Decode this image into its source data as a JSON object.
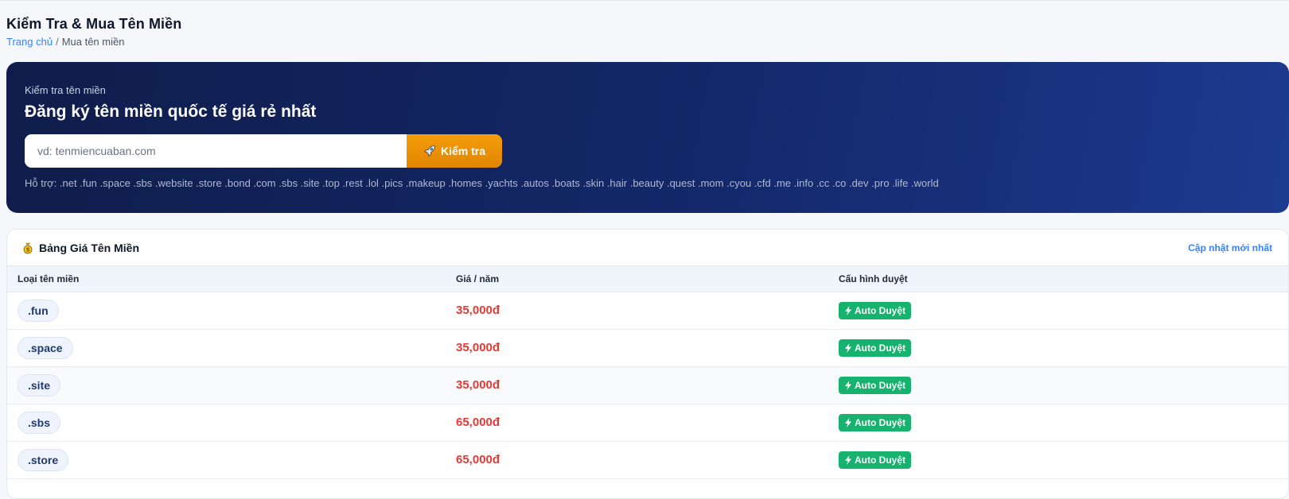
{
  "header": {
    "title": "Kiểm Tra & Mua Tên Miền",
    "breadcrumb": {
      "home": "Trang chủ",
      "separator": "/",
      "current": "Mua tên miền"
    }
  },
  "hero": {
    "eyebrow": "Kiểm tra tên miền",
    "heading": "Đăng ký tên miền quốc tế giá rẻ nhất",
    "search": {
      "placeholder": "vd: tenmiencuaban.com",
      "value": ""
    },
    "button_label": "Kiểm tra",
    "button_icon": "rocket-icon",
    "support_text": "Hỗ trợ: .net .fun .space .sbs .website .store .bond .com .sbs .site .top .rest .lol .pics .makeup .homes .yachts .autos .boats .skin .hair .beauty .quest .mom .cyou .cfd .me .info .cc .co .dev .pro .life .world"
  },
  "price_table": {
    "title": "Bảng Giá Tên Miền",
    "title_icon": "moneybag-icon",
    "update_link": "Cập nhật mới nhất",
    "columns": [
      "Loại tên miền",
      "Giá / năm",
      "Cấu hình duyệt"
    ],
    "rows": [
      {
        "ext": ".fun",
        "price": "35,000đ",
        "config": "Auto Duyệt"
      },
      {
        "ext": ".space",
        "price": "35,000đ",
        "config": "Auto Duyệt"
      },
      {
        "ext": ".site",
        "price": "35,000đ",
        "config": "Auto Duyệt"
      },
      {
        "ext": ".sbs",
        "price": "65,000đ",
        "config": "Auto Duyệt"
      },
      {
        "ext": ".store",
        "price": "65,000đ",
        "config": "Auto Duyệt"
      }
    ]
  },
  "colors": {
    "hero_start": "#0f1d4a",
    "hero_end": "#1c3a8f",
    "accent_orange": "#f59e0b",
    "price_red": "#e53935",
    "badge_green": "#16b26e",
    "link_blue": "#3b82f6"
  }
}
